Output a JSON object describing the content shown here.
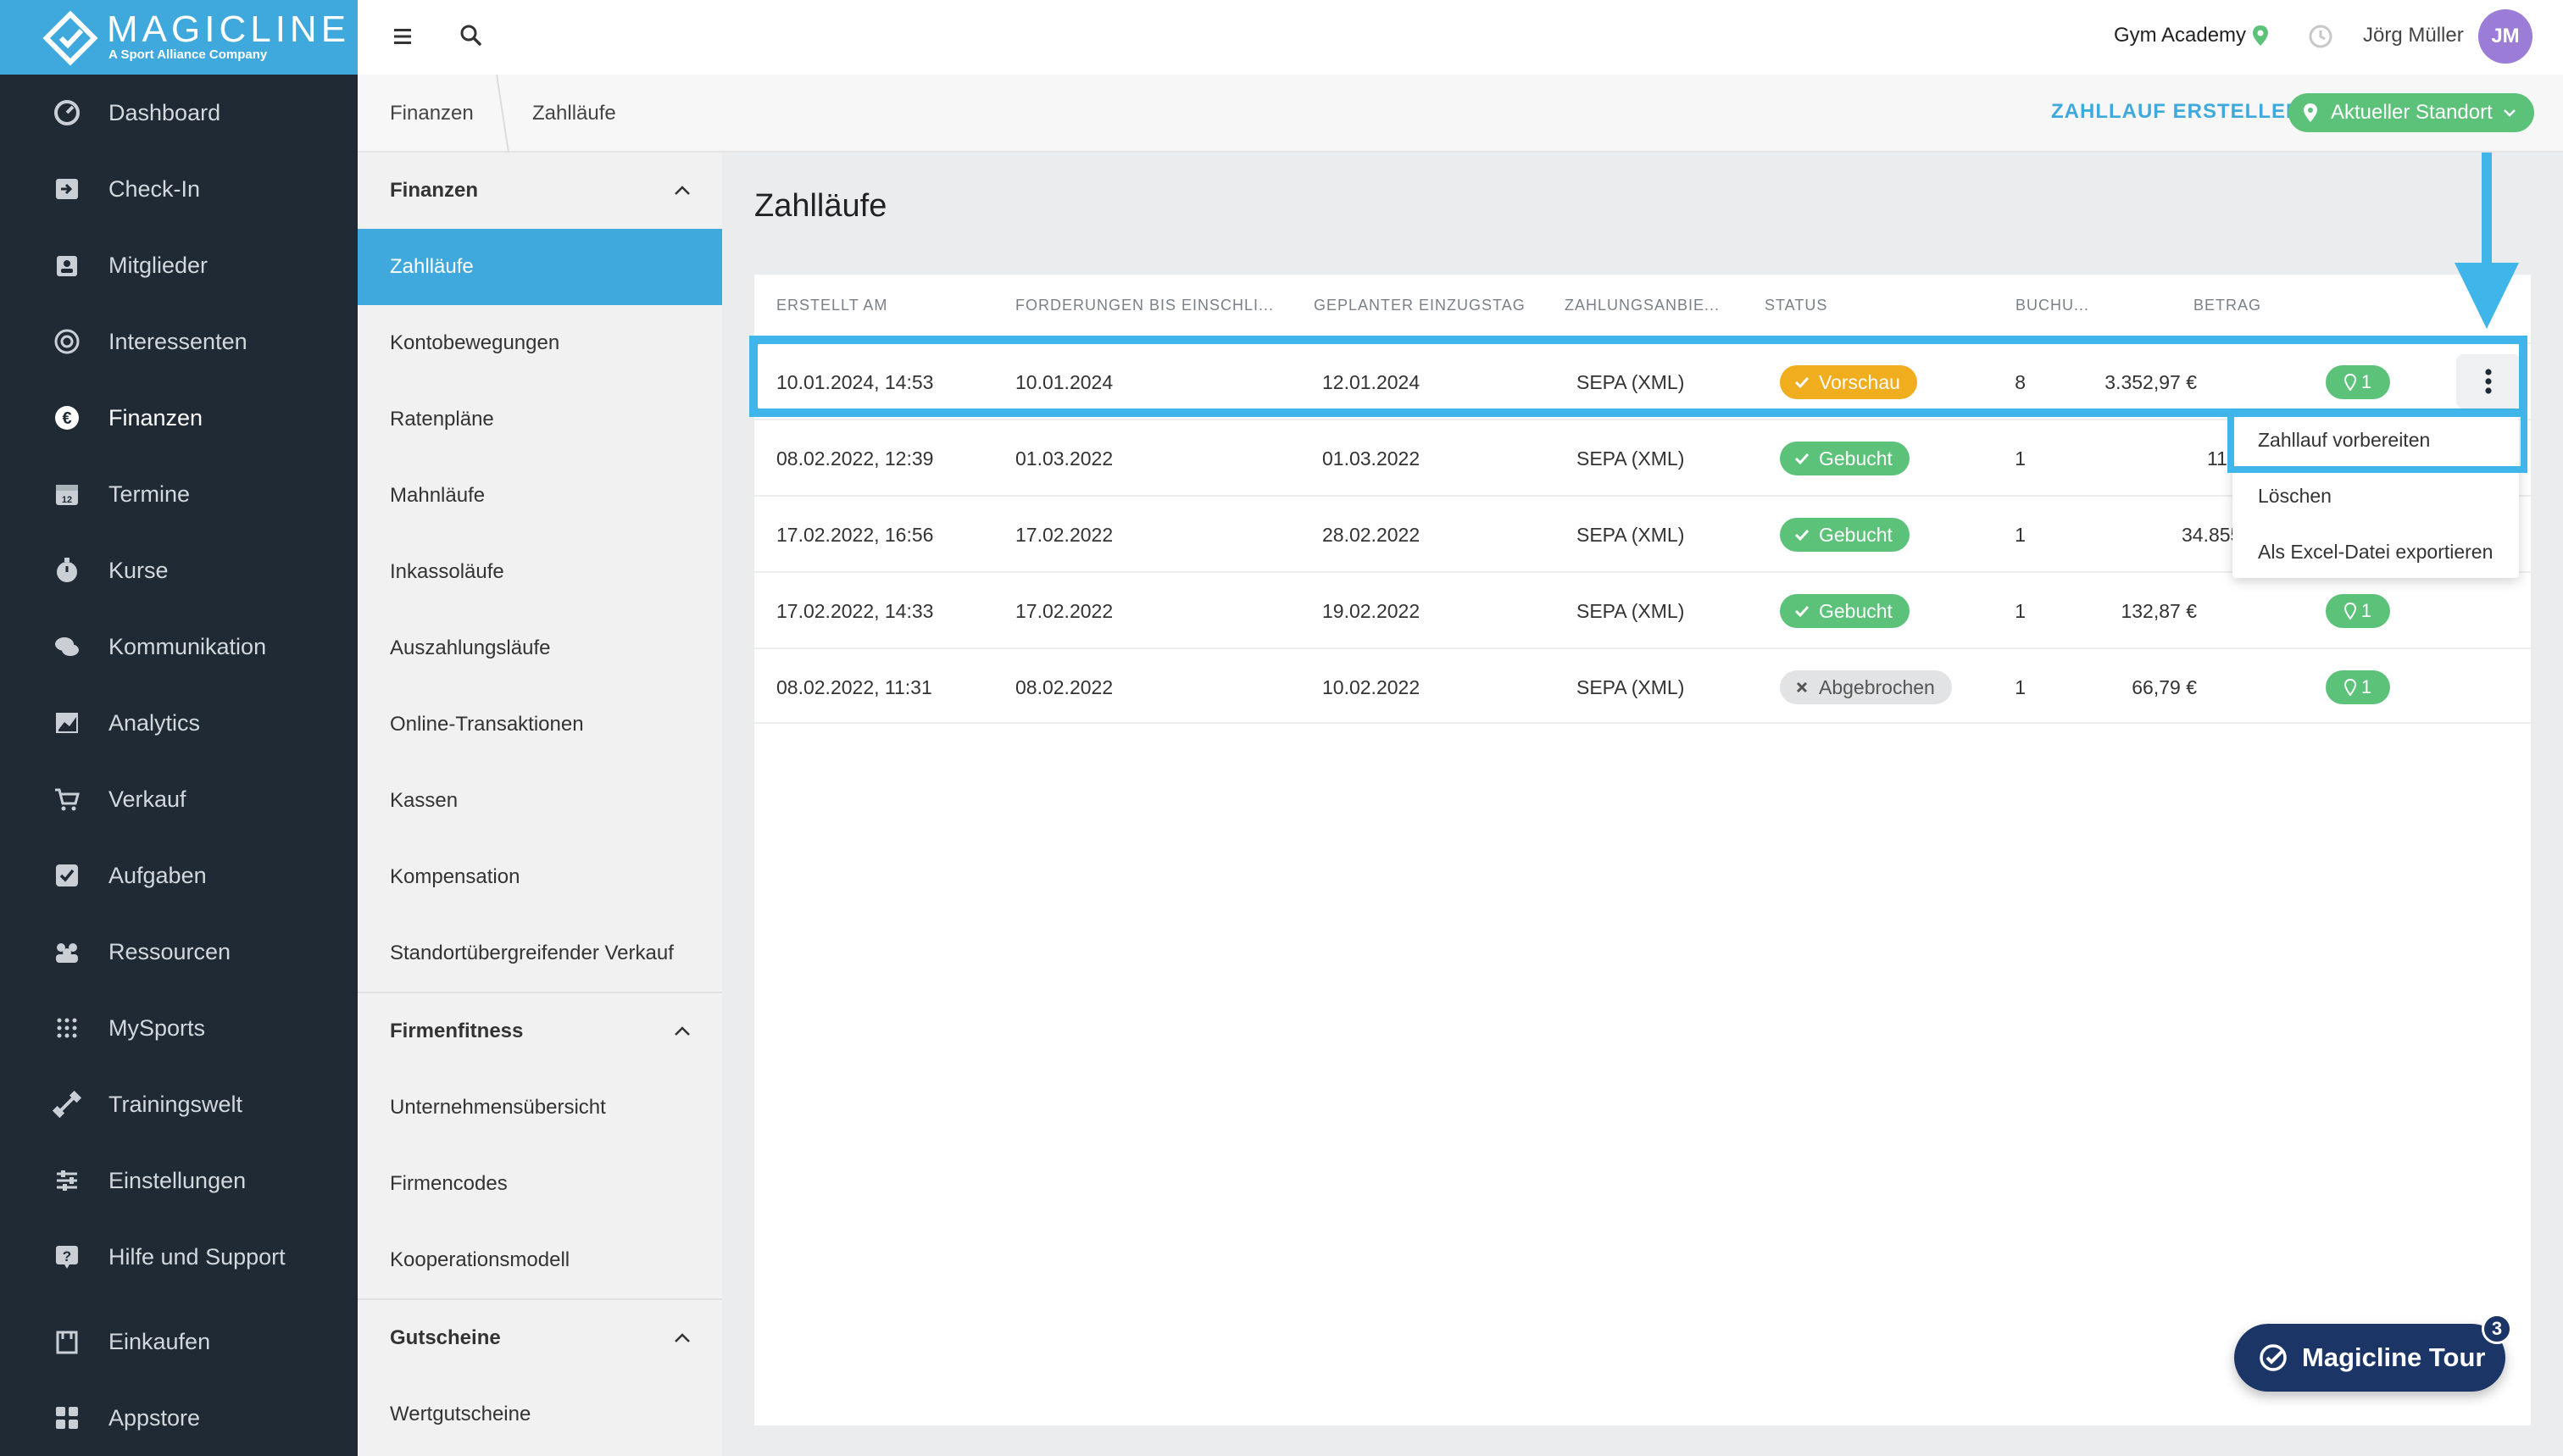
{
  "brand": {
    "name": "MAGICLINE",
    "tagline": "A Sport Alliance Company",
    "accent": "#3fa9dd",
    "sidebar_bg": "#1f2a34"
  },
  "sidebar": {
    "items": [
      {
        "label": "Dashboard",
        "icon": "dashboard-icon"
      },
      {
        "label": "Check-In",
        "icon": "check-in-icon"
      },
      {
        "label": "Mitglieder",
        "icon": "members-icon"
      },
      {
        "label": "Interessenten",
        "icon": "prospects-icon"
      },
      {
        "label": "Finanzen",
        "icon": "euro-icon",
        "active": true
      },
      {
        "label": "Termine",
        "icon": "calendar-icon"
      },
      {
        "label": "Kurse",
        "icon": "stopwatch-icon"
      },
      {
        "label": "Kommunikation",
        "icon": "chat-icon"
      },
      {
        "label": "Analytics",
        "icon": "chart-icon"
      },
      {
        "label": "Verkauf",
        "icon": "cart-icon"
      },
      {
        "label": "Aufgaben",
        "icon": "checkbox-icon"
      },
      {
        "label": "Ressourcen",
        "icon": "group-icon"
      },
      {
        "label": "MySports",
        "icon": "dots-grid-icon"
      },
      {
        "label": "Trainingswelt",
        "icon": "dumbbell-icon"
      },
      {
        "label": "Einstellungen",
        "icon": "sliders-icon"
      },
      {
        "label": "Hilfe und Support",
        "icon": "help-icon"
      },
      {
        "label": "Einkaufen",
        "icon": "shop-icon"
      },
      {
        "label": "Appstore",
        "icon": "apps-icon"
      }
    ]
  },
  "topbar": {
    "gym": "Gym Academy",
    "user": "Jörg Müller",
    "initials": "JM"
  },
  "breadcrumb": {
    "items": [
      "Finanzen",
      "Zahlläufe"
    ],
    "create_label": "ZAHLLAUF ERSTELLEN",
    "location_label": "Aktueller Standort"
  },
  "subnav": {
    "sections": [
      {
        "title": "Finanzen",
        "items": [
          "Zahlläufe",
          "Kontobewegungen",
          "Ratenpläne",
          "Mahnläufe",
          "Inkassoläufe",
          "Auszahlungsläufe",
          "Online-Transaktionen",
          "Kassen",
          "Kompensation",
          "Standortübergreifender Verkauf"
        ]
      },
      {
        "title": "Firmenfitness",
        "items": [
          "Unternehmensübersicht",
          "Firmencodes",
          "Kooperationsmodell"
        ]
      },
      {
        "title": "Gutscheine",
        "items": [
          "Wertgutscheine"
        ]
      }
    ],
    "active_item": "Zahlläufe"
  },
  "main": {
    "title": "Zahlläufe",
    "columns": [
      "ERSTELLT AM",
      "FORDERUNGEN BIS EINSCHLI...",
      "GEPLANTER EINZUGSTAG",
      "ZAHLUNGSANBIE...",
      "STATUS",
      "BUCHU...",
      "BETRAG"
    ],
    "rows": [
      {
        "created": "10.01.2024, 14:53",
        "claims_until": "10.01.2024",
        "planned": "12.01.2024",
        "provider": "SEPA (XML)",
        "status": "Vorschau",
        "status_type": "preview",
        "bookings": "8",
        "amount": "3.352,97 €",
        "locations": "1"
      },
      {
        "created": "08.02.2022, 12:39",
        "claims_until": "01.03.2022",
        "planned": "01.03.2022",
        "provider": "SEPA (XML)",
        "status": "Gebucht",
        "status_type": "booked",
        "bookings": "1",
        "amount": "11",
        "locations": ""
      },
      {
        "created": "17.02.2022, 16:56",
        "claims_until": "17.02.2022",
        "planned": "28.02.2022",
        "provider": "SEPA (XML)",
        "status": "Gebucht",
        "status_type": "booked",
        "bookings": "1",
        "amount": "34.855",
        "locations": ""
      },
      {
        "created": "17.02.2022, 14:33",
        "claims_until": "17.02.2022",
        "planned": "19.02.2022",
        "provider": "SEPA (XML)",
        "status": "Gebucht",
        "status_type": "booked",
        "bookings": "1",
        "amount": "132,87 €",
        "locations": "1"
      },
      {
        "created": "08.02.2022, 11:31",
        "claims_until": "08.02.2022",
        "planned": "10.02.2022",
        "provider": "SEPA (XML)",
        "status": "Abgebrochen",
        "status_type": "aborted",
        "bookings": "1",
        "amount": "66,79 €",
        "locations": "1"
      }
    ]
  },
  "dropdown": {
    "items": [
      "Zahllauf vorbereiten",
      "Löschen",
      "Als Excel-Datei exportieren"
    ]
  },
  "tour": {
    "label": "Magicline Tour",
    "count": "3"
  },
  "colors": {
    "preview": "#f0ad1e",
    "booked": "#5cc27a",
    "aborted": "#e2e3e4",
    "highlight": "#3fb5e9",
    "tour": "#1b3566"
  }
}
